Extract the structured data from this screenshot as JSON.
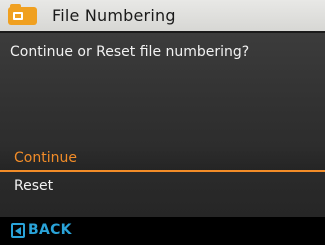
{
  "header": {
    "icon": "folder-icon",
    "title": "File Numbering"
  },
  "message": "Continue or Reset file numbering?",
  "options": [
    {
      "label": "Continue",
      "selected": true
    },
    {
      "label": "Reset",
      "selected": false
    }
  ],
  "footer": {
    "back_icon": "back-arrow-key-icon",
    "back_label": "BACK"
  },
  "colors": {
    "accent": "#f28c28",
    "footer_text": "#2aa3d8",
    "title_bar": "#d9d9d6",
    "text": "#f2f2f2"
  }
}
